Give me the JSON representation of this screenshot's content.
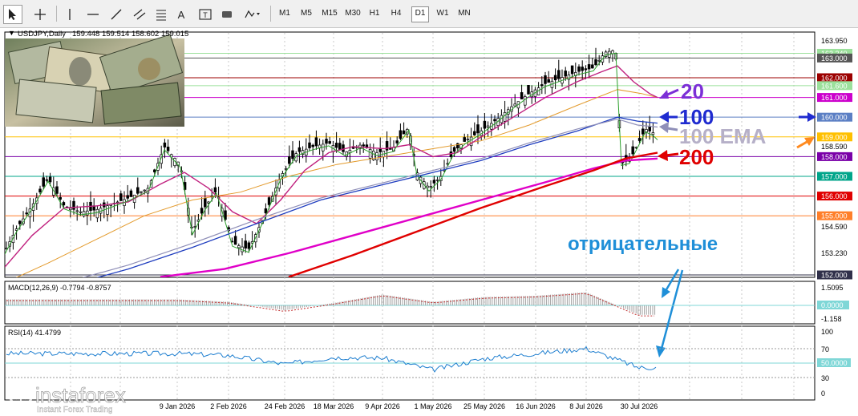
{
  "toolbar": {
    "tools": [
      "cursor-icon",
      "crosshair-icon",
      "vertical-line-icon",
      "horizontal-line-icon",
      "trendline-icon",
      "channel-icon",
      "fibonacci-icon",
      "text-tool",
      "label-icon",
      "shapes-icon",
      "more-tools-icon"
    ],
    "text_tool_label": "A",
    "label_tool_label": "T",
    "timeframes": [
      "M1",
      "M5",
      "M15",
      "M30",
      "H1",
      "H4",
      "D1",
      "W1",
      "MN"
    ],
    "active_timeframe": "D1"
  },
  "main_panel": {
    "symbol_label": "USDJPY,Daily",
    "ohlc": "159.448 159.514 158.602 159.015",
    "price_ticks": [
      "163.950",
      "158.590",
      "154.590",
      "153.230"
    ],
    "levels": [
      {
        "value": "163.240",
        "color": "#9be09b",
        "text_color": "#ffffff"
      },
      {
        "value": "163.000",
        "color": "#555555",
        "text_color": "#ffffff"
      },
      {
        "value": "162.000",
        "color": "#9c0000",
        "text_color": "#ffffff"
      },
      {
        "value": "161.600",
        "color": "#9be09b",
        "text_color": "#ffffff"
      },
      {
        "value": "161.000",
        "color": "#cc00cc",
        "text_color": "#ffffff"
      },
      {
        "value": "160.000",
        "color": "#5b7fc4",
        "text_color": "#ffffff"
      },
      {
        "value": "159.000",
        "color": "#ffc000",
        "text_color": "#ffffff"
      },
      {
        "value": "158.000",
        "color": "#7a00a8",
        "text_color": "#ffffff"
      },
      {
        "value": "157.000",
        "color": "#00a58a",
        "text_color": "#ffffff"
      },
      {
        "value": "156.000",
        "color": "#e00000",
        "text_color": "#ffffff"
      },
      {
        "value": "155.000",
        "color": "#ff7f2a",
        "text_color": "#ffffff"
      },
      {
        "value": "152.000",
        "color": "#30304a",
        "text_color": "#ffffff"
      }
    ],
    "annotations": {
      "ma20": "20",
      "ma100": "100",
      "ema100": "100 EMA",
      "ma200": "200",
      "negative": "отрицательные"
    }
  },
  "macd_panel": {
    "label": "MACD(12,26,9) -0.7794 -0.8757",
    "ticks": [
      "1.5095",
      "0.0000",
      "-1.158"
    ]
  },
  "rsi_panel": {
    "label": "RSI(14) 41.4799",
    "ticks": [
      "100",
      "70",
      "50",
      "30",
      "0"
    ],
    "level_label": "50.0000"
  },
  "time_axis": [
    "9 Jan 2026",
    "2 Feb 2026",
    "24 Feb 2026",
    "18 Mar 2026",
    "9 Apr 2026",
    "1 May 2026",
    "25 May 2026",
    "16 Jun 2026",
    "8 Jul 2026",
    "30 Jul 2026"
  ],
  "watermark": {
    "brand": "instaforex",
    "tagline": "Instant Forex Trading"
  },
  "colors": {
    "ma20": "#7b2fd6",
    "ma100": "#1f2bd0",
    "ema100": "#8f8fb8",
    "ma200": "#e00000",
    "negative": "#1f8fd8"
  },
  "chart_data": {
    "type": "line",
    "title": "USDJPY,Daily",
    "ohlc_last": {
      "open": 159.448,
      "high": 159.514,
      "low": 158.602,
      "close": 159.015
    },
    "price_axis": [
      152,
      164
    ],
    "dates": [
      "9 Jan 2026",
      "2 Feb 2026",
      "24 Feb 2026",
      "18 Mar 2026",
      "9 Apr 2026",
      "1 May 2026",
      "25 May 2026",
      "16 Jun 2026",
      "8 Jul 2026",
      "30 Jul 2026"
    ],
    "series": [
      {
        "name": "20",
        "values": [
          155.4,
          155.8,
          154.3,
          156.5,
          157.4,
          156.7,
          157.9,
          160.2,
          162.3,
          160.9
        ]
      },
      {
        "name": "100",
        "values": [
          152.3,
          152.9,
          153.4,
          154.5,
          156.0,
          157.0,
          157.5,
          158.6,
          159.9,
          159.8
        ]
      },
      {
        "name": "100 EMA",
        "values": [
          152.6,
          153.2,
          153.8,
          154.8,
          156.2,
          157.1,
          157.6,
          158.7,
          159.7,
          159.7
        ]
      },
      {
        "name": "200",
        "values": [
          151.0,
          151.3,
          151.8,
          152.6,
          153.8,
          154.6,
          155.6,
          156.6,
          157.5,
          158.1
        ]
      }
    ],
    "macd": {
      "values": [
        0.5,
        0.3,
        -0.4,
        0.2,
        0.9,
        0.3,
        0.7,
        0.8,
        1.1,
        -0.78
      ],
      "signal": -0.8757,
      "ylim": [
        -1.158,
        1.5095
      ]
    },
    "rsi": {
      "values": [
        64,
        61,
        47,
        58,
        57,
        38,
        56,
        64,
        72,
        41.48
      ],
      "levels": [
        30,
        50,
        70
      ],
      "ylim": [
        0,
        100
      ]
    }
  }
}
